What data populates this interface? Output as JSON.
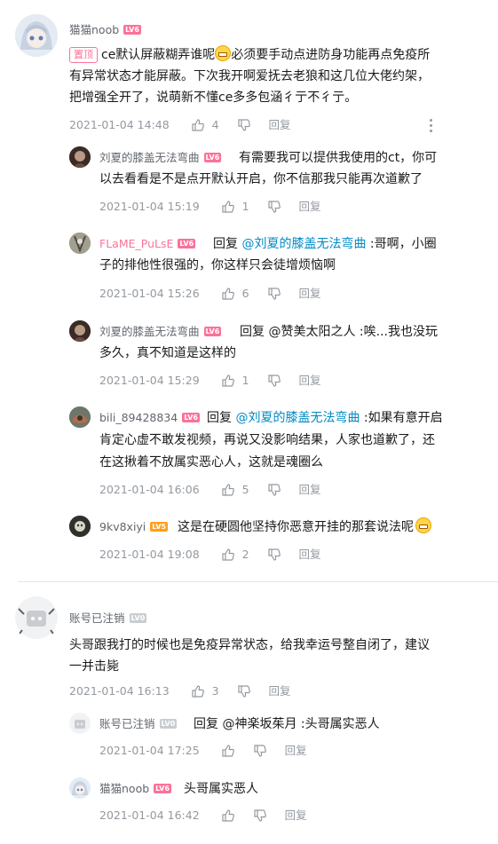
{
  "comments": [
    {
      "user": "猫猫noob",
      "level": "LV6",
      "pin": "置顶",
      "text_a": "ce默认屏蔽糊弄谁呢",
      "text_b": "必须要手动点进防身功能再点免疫所",
      "text_line2": "有异常状态才能屏蔽。下次我开啊爱抚去老狼和这几位大佬约架，",
      "text_line3": "把增强全开了，说萌新不懂ce多多包涵彳亍不彳亍。",
      "time": "2021-01-04 14:48",
      "likes": "4",
      "reply": "回复"
    },
    {
      "user": "刘夏的膝盖无法弯曲",
      "level": "LV6",
      "text_line1": "有需要我可以提供我使用的ct，你可",
      "text_line2": "以去看看是不是点开默认开启，你不信那我只能再次道歉了",
      "time": "2021-01-04 15:19",
      "likes": "1",
      "reply": "回复"
    },
    {
      "user": "FLaME_PuLsE",
      "level": "LV6",
      "reply_prefix": "回复",
      "at": "@刘夏的膝盖无法弯曲",
      "text_rest": ":哥啊，小圈",
      "text_line2": "子的排他性很强的，你这样只会徒增烦恼啊",
      "time": "2021-01-04 15:26",
      "likes": "6",
      "reply": "回复"
    },
    {
      "user": "刘夏的膝盖无法弯曲",
      "level": "LV6",
      "reply_prefix": "回复",
      "at": "@赞美太阳之人",
      "text_rest": ":唉...我也没玩",
      "text_line2": "多久，真不知道是这样的",
      "time": "2021-01-04 15:29",
      "likes": "1",
      "reply": "回复"
    },
    {
      "user": "bili_89428834",
      "level": "LV6",
      "reply_prefix": "回复",
      "at": "@刘夏的膝盖无法弯曲",
      "text_rest": ":如果有意开启",
      "text_line2": "肯定心虚不敢发视频，再说又没影响结果，人家也道歉了，还",
      "text_line3": "在这揪着不放属实恶心人，这就是魂圈么",
      "time": "2021-01-04 16:06",
      "likes": "5",
      "reply": "回复"
    },
    {
      "user": "9kv8xiyi",
      "level": "LV5",
      "text_line1": "这是在硬圆他坚持你恶意开挂的那套说法呢",
      "time": "2021-01-04 19:08",
      "likes": "2",
      "reply": "回复"
    },
    {
      "user": "账号已注销",
      "level": "LV0",
      "text_line1": "头哥跟我打的时候也是免疫异常状态，给我幸运号整自闭了，建议",
      "text_line2": "一并击毙",
      "time": "2021-01-04 16:13",
      "likes": "3",
      "reply": "回复"
    },
    {
      "user": "账号已注销",
      "level": "LV0",
      "reply_prefix": "回复",
      "at": "@神楽坂茱月",
      "text_rest": ":头哥属实恶人",
      "time": "2021-01-04 17:25",
      "likes": "",
      "reply": "回复"
    },
    {
      "user": "猫猫noob",
      "level": "LV6",
      "text_line1": "头哥属实恶人",
      "time": "2021-01-04 16:42",
      "likes": "",
      "reply": "回复"
    }
  ]
}
